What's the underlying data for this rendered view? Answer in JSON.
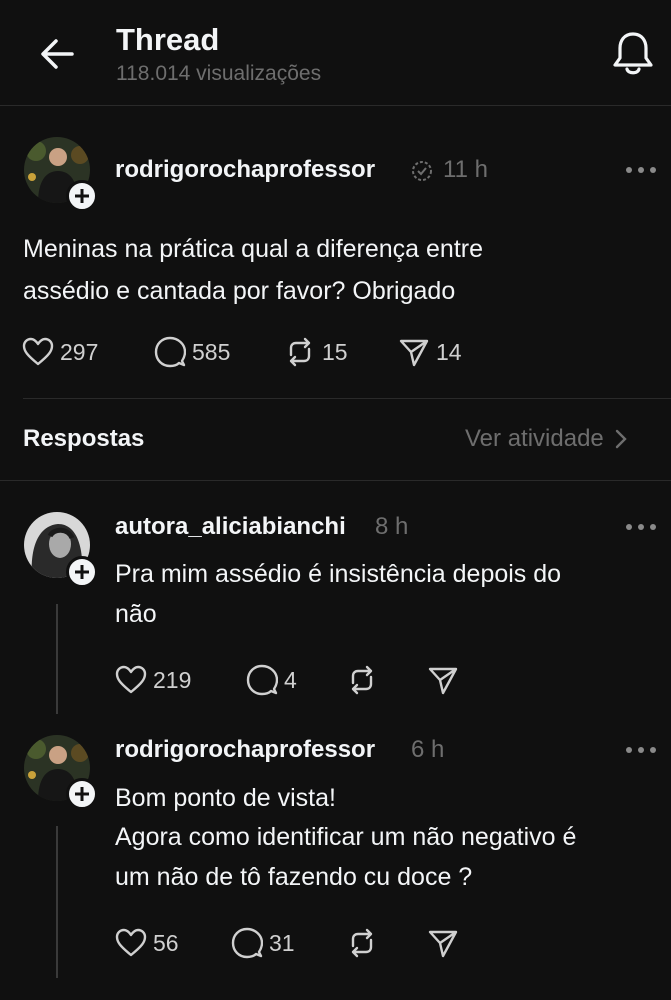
{
  "header": {
    "title": "Thread",
    "views": "118.014 visualizações"
  },
  "post": {
    "username": "rodrigorochaprofessor",
    "time": "11 h",
    "text_line1": "Meninas na prática qual a diferença entre",
    "text_line2": "assédio e cantada por favor?  Obrigado",
    "likes": "297",
    "comments": "585",
    "reposts": "15",
    "shares": "14"
  },
  "replies_section": {
    "title": "Respostas",
    "activity_link": "Ver atividade"
  },
  "replies": [
    {
      "username": "autora_aliciabianchi",
      "time": "8 h",
      "text_line1": "Pra mim assédio é insistência depois do",
      "text_line2": "não",
      "likes": "219",
      "comments": "4"
    },
    {
      "username": "rodrigorochaprofessor",
      "time": "6 h",
      "text_line1": "Bom ponto de vista!",
      "text_line2": "Agora como identificar um não negativo é",
      "text_line3": "um não de tô fazendo cu doce ?",
      "likes": "56",
      "comments": "31"
    }
  ],
  "icons": {
    "back": "arrow-left-icon",
    "notifications": "bell-icon",
    "more": "more-horizontal-icon",
    "like": "heart-icon",
    "comment": "comment-icon",
    "repost": "repost-icon",
    "share": "send-icon"
  },
  "colors": {
    "background": "#101010",
    "text": "#f3f5f7",
    "muted": "#6e6e6e",
    "divider": "#2a2a2a"
  }
}
